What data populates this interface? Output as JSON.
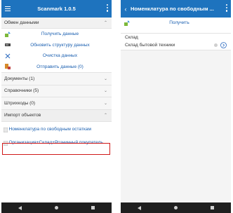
{
  "left": {
    "title": "Scanmark 1.0.5",
    "exchange_header": "Обмен данными",
    "actions": [
      {
        "label": "Получить данные",
        "icon": "download-icon"
      },
      {
        "label": "Обновить структуру данных",
        "icon": "scanner-icon"
      },
      {
        "label": "Очистка данных",
        "icon": "close-icon"
      },
      {
        "label": "Отправить данные (0)",
        "icon": "upload-icon"
      }
    ],
    "categories": [
      {
        "label": "Документы (1)"
      },
      {
        "label": "Справочники (5)"
      },
      {
        "label": "Штрихкоды (0)"
      },
      {
        "label": "Импорт объектов"
      }
    ],
    "import_items": [
      {
        "label": "Номенклатура по свободным остаткам"
      },
      {
        "label": "Организация+Склад+Розничный покупатель"
      }
    ]
  },
  "right": {
    "title": "Номенклатура по свободным ...",
    "action_label": "Получить",
    "field_label": "Склад",
    "field_value": "Склад бытовой техники"
  },
  "colors": {
    "toolbar": "#1E73BE",
    "highlight": "#d01818",
    "link": "#1a5fb0"
  }
}
